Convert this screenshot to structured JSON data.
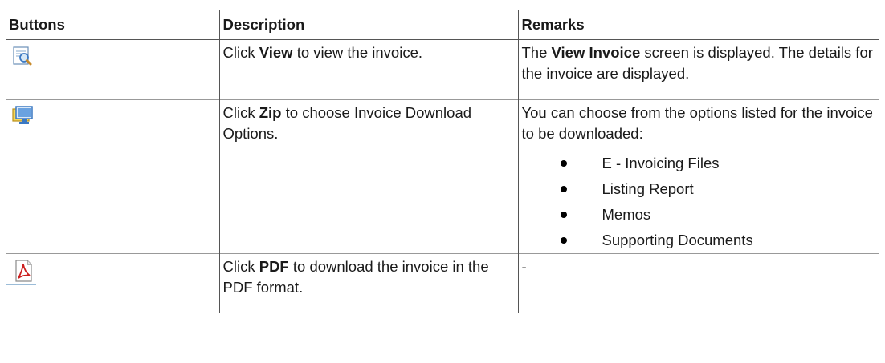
{
  "table": {
    "headers": {
      "buttons": "Buttons",
      "description": "Description",
      "remarks": "Remarks"
    },
    "rows": {
      "view": {
        "icon": "view-invoice-icon",
        "desc_prefix": "Click ",
        "desc_bold": "View",
        "desc_suffix": " to view the invoice.",
        "remark_prefix": "The ",
        "remark_bold": "View Invoice",
        "remark_suffix": " screen is displayed. The details for the invoice are displayed."
      },
      "zip": {
        "icon": "zip-download-icon",
        "desc_prefix": "Click ",
        "desc_bold": "Zip",
        "desc_suffix": " to choose Invoice Download Options.",
        "remark_text": "You can choose from the options listed for the invoice to be downloaded:",
        "options": [
          "E - Invoicing Files",
          "Listing Report",
          "Memos",
          "Supporting Documents"
        ]
      },
      "pdf": {
        "icon": "pdf-icon",
        "desc_prefix": "Click ",
        "desc_bold": "PDF",
        "desc_suffix": " to download the invoice in the PDF format.",
        "remark_text": "-"
      }
    }
  },
  "colors": {
    "border": "#555555",
    "icon_blue": "#3a78c2",
    "icon_yellow": "#f2c230",
    "pdf_red": "#cc1f1f"
  }
}
